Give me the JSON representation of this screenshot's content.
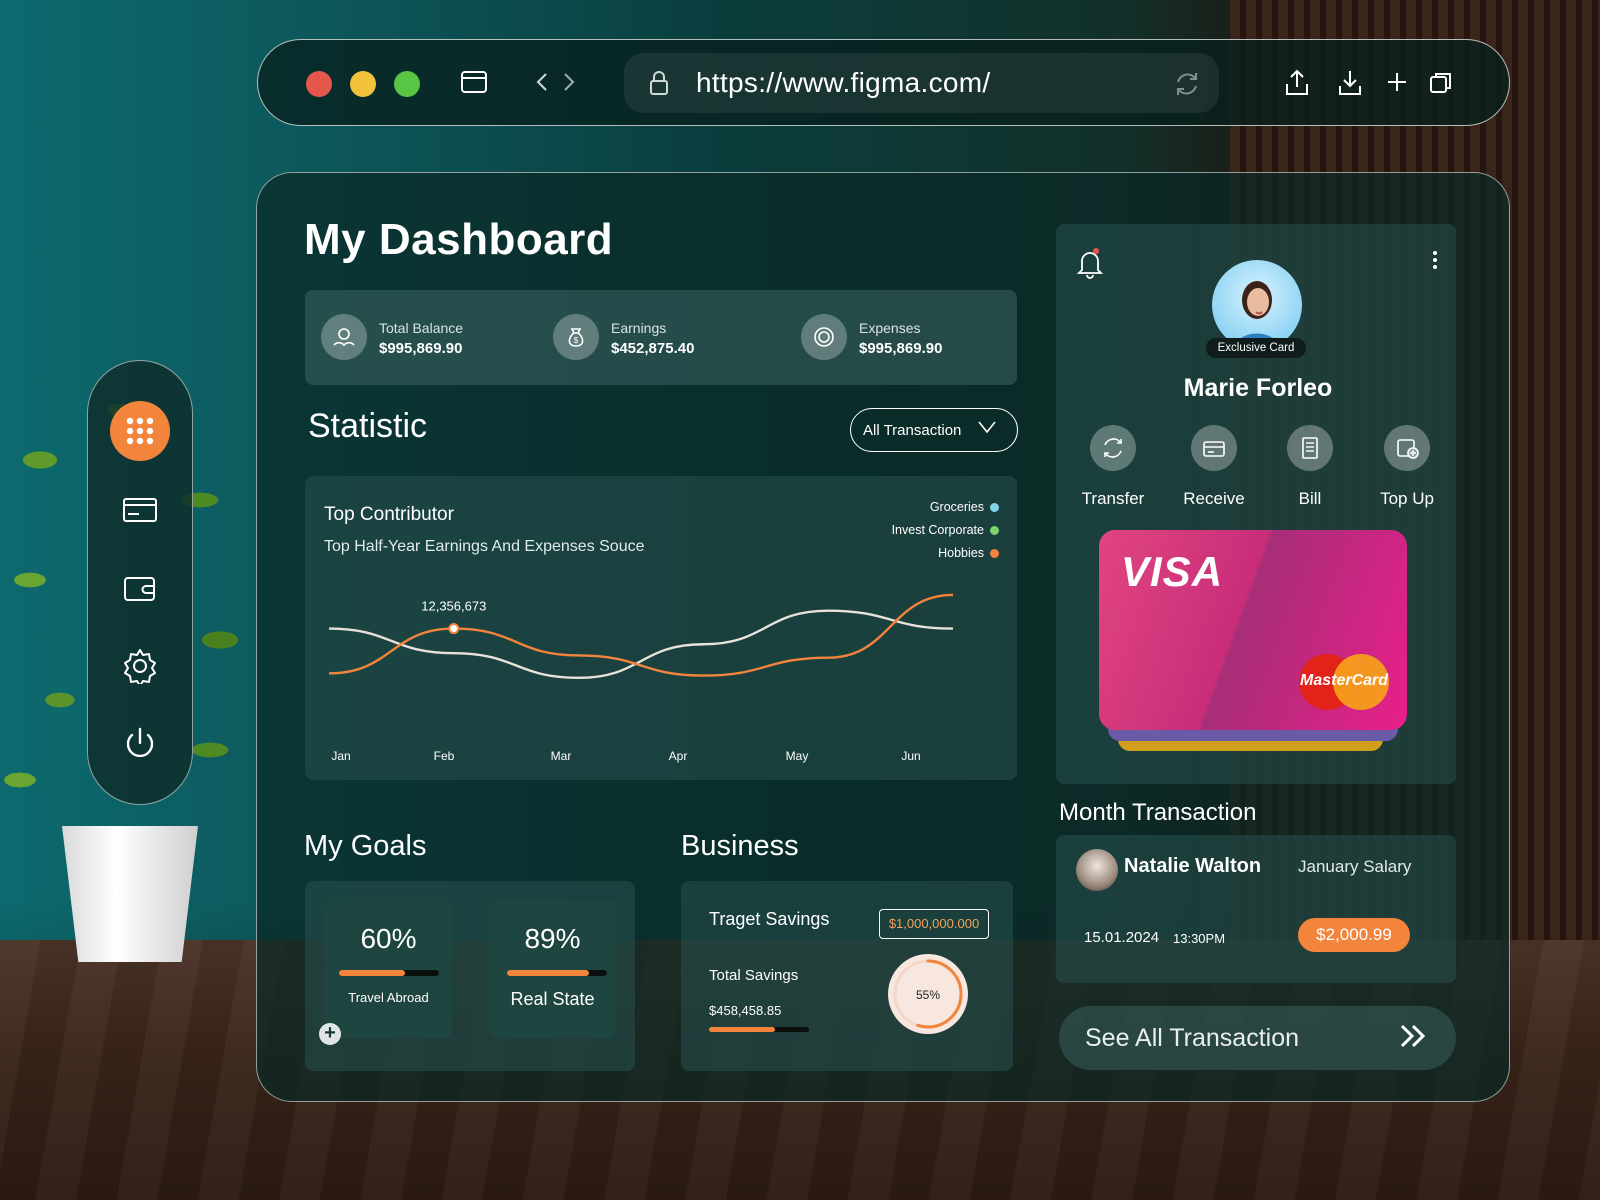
{
  "browser": {
    "url": "https://www.figma.com/",
    "traffic_lights": [
      "#e5574b",
      "#f3c23c",
      "#58c545"
    ]
  },
  "sidebar": {
    "items": [
      {
        "icon": "apps-grid-icon",
        "active": true
      },
      {
        "icon": "credit-card-icon",
        "active": false
      },
      {
        "icon": "wallet-icon",
        "active": false
      },
      {
        "icon": "settings-gear-icon",
        "active": false
      },
      {
        "icon": "power-icon",
        "active": false
      }
    ]
  },
  "dashboard": {
    "title": "My Dashboard",
    "summary": [
      {
        "label": "Total Balance",
        "value": "$995,869.90",
        "icon": "money-hands-icon"
      },
      {
        "label": "Earnings",
        "value": "$452,875.40",
        "icon": "money-bag-icon"
      },
      {
        "label": "Expenses",
        "value": "$995,869.90",
        "icon": "coins-icon"
      }
    ]
  },
  "statistic": {
    "title": "Statistic",
    "filter": "All Transaction",
    "card_title": "Top Contributor",
    "card_subtitle": "Top Half-Year Earnings And Expenses Souce",
    "legend": [
      {
        "name": "Groceries",
        "color": "#7fd6ea"
      },
      {
        "name": "Invest Corporate",
        "color": "#7fd36b"
      },
      {
        "name": "Hobbies",
        "color": "#f2843b"
      }
    ],
    "callout": "12,356,673"
  },
  "chart_data": {
    "type": "line",
    "x": [
      "Jan",
      "Feb",
      "Mar",
      "Apr",
      "May",
      "Jun"
    ],
    "series": [
      {
        "color": "#e8e2da",
        "values": [
          0.62,
          0.4,
          0.18,
          0.48,
          0.78,
          0.62
        ]
      },
      {
        "color": "#f2843b",
        "values": [
          0.22,
          0.62,
          0.38,
          0.2,
          0.36,
          0.92
        ]
      }
    ],
    "highlight": {
      "series_index": 1,
      "x": "Feb",
      "label": "12,356,673"
    },
    "grid": false
  },
  "goals": {
    "title": "My Goals",
    "items": [
      {
        "percent": "60%",
        "progress": 0.66,
        "label": "Travel Abroad"
      },
      {
        "percent": "89%",
        "progress": 0.82,
        "label": "Real State"
      }
    ]
  },
  "business": {
    "title": "Business",
    "target_label": "Traget Savings",
    "target_value": "$1,000,000.000",
    "total_label": "Total Savings",
    "total_value": "$458,458.85",
    "total_progress": 0.66,
    "ring_percent": "55%",
    "ring_fraction": 0.55
  },
  "profile": {
    "badge": "Exclusive Card",
    "name": "Marie Forleo",
    "actions": [
      {
        "label": "Transfer",
        "icon": "transfer-icon"
      },
      {
        "label": "Receive",
        "icon": "receive-icon"
      },
      {
        "label": "Bill",
        "icon": "bill-icon"
      },
      {
        "label": "Top Up",
        "icon": "top-up-icon"
      }
    ],
    "card": {
      "brand": "VISA",
      "network": "MasterCard"
    }
  },
  "transactions": {
    "title": "Month Transaction",
    "item": {
      "name": "Natalie Walton",
      "description": "January Salary",
      "date": "15.01.2024",
      "time": "13:30PM",
      "amount": "$2,000.99"
    },
    "see_all": "See All Transaction"
  }
}
